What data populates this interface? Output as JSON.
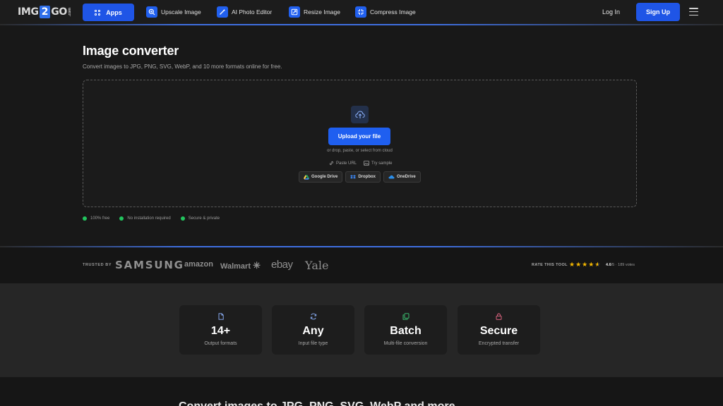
{
  "header": {
    "logo_prefix": "IMG",
    "logo_number": "2",
    "logo_suffix": "GO",
    "logo_tld": ".com",
    "apps_label": "Apps",
    "nav_links": [
      {
        "label": "Upscale Image",
        "icon": "magnify-plus-icon"
      },
      {
        "label": "AI Photo Editor",
        "icon": "magic-wand-icon"
      },
      {
        "label": "Resize Image",
        "icon": "resize-icon"
      },
      {
        "label": "Compress Image",
        "icon": "compress-icon"
      }
    ],
    "login_label": "Log In",
    "signup_label": "Sign Up"
  },
  "hero": {
    "title": "Image converter",
    "subtitle": "Convert images to JPG, PNG, SVG, WebP, and 10 more formats online for free.",
    "upload_button": "Upload your file",
    "drop_hint": "or drop, paste, or select from cloud",
    "paste_url": "Paste URL",
    "try_sample": "Try sample",
    "cloud_sources": [
      "Google Drive",
      "Dropbox",
      "OneDrive"
    ],
    "features": [
      "100% free",
      "No installation required",
      "Secure & private"
    ]
  },
  "trusted": {
    "label": "TRUSTED BY",
    "brands": [
      "SAMSUNG",
      "amazon",
      "Walmart",
      "ebay",
      "Yale"
    ],
    "rate_label": "RATE THIS TOOL",
    "rating_value": "4.6",
    "rating_rest": "/5 · 189 votes",
    "stars": 4.6
  },
  "stats": [
    {
      "value": "14+",
      "label": "Output formats",
      "icon": "file-icon"
    },
    {
      "value": "Any",
      "label": "Input file type",
      "icon": "refresh-icon"
    },
    {
      "value": "Batch",
      "label": "Multi-file conversion",
      "icon": "copy-icon"
    },
    {
      "value": "Secure",
      "label": "Encrypted transfer",
      "icon": "lock-icon"
    }
  ],
  "bottom": {
    "heading": "Convert images to JPG, PNG, SVG, WebP and more"
  },
  "colors": {
    "accent": "#1f55e6",
    "background": "#181818",
    "success": "#22c55e",
    "star": "#f5b800"
  }
}
